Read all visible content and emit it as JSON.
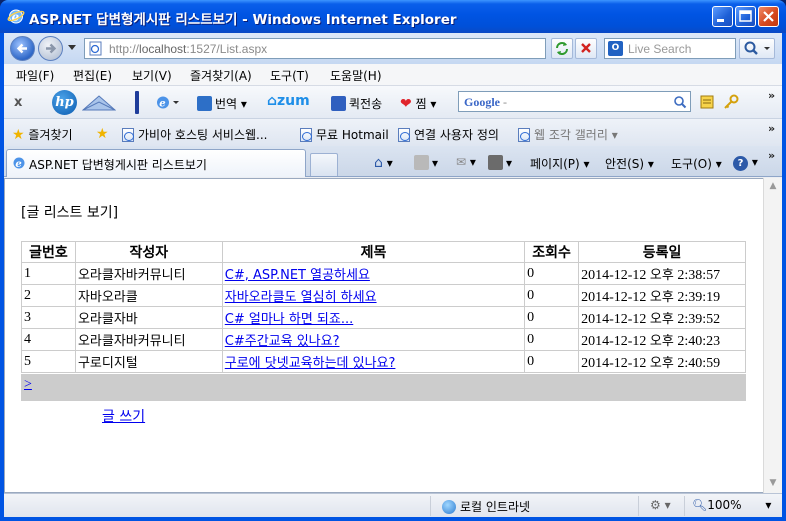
{
  "window": {
    "title": "ASP.NET 답변형게시판 리스트보기 - Windows Internet Explorer"
  },
  "address_bar": {
    "url_prefix": "http://",
    "url_host": "localhost",
    "url_rest": ":1527/List.aspx",
    "search_placeholder": "Live Search"
  },
  "menu": [
    "파일(F)",
    "편집(E)",
    "보기(V)",
    "즐겨찾기(A)",
    "도구(T)",
    "도움말(H)"
  ],
  "toolbar": {
    "close": "x",
    "translate": "번역",
    "zum": "zum",
    "quick_send": "퀵전송",
    "favorite": "찜",
    "google": "Google",
    "google_placeholder": "-"
  },
  "favorites_bar": {
    "label": "즐겨찾기",
    "items": [
      "가비아 호스팅 서비스웹...",
      "무료 Hotmail",
      "연결 사용자 정의",
      "웹 조각 갤러리"
    ]
  },
  "tab": {
    "label": "ASP.NET 답변형게시판 리스트보기"
  },
  "command_bar": {
    "page": "페이지(P)",
    "safety": "안전(S)",
    "tools": "도구(O)"
  },
  "page": {
    "heading": "[글 리스트 보기]",
    "columns": [
      "글번호",
      "작성자",
      "제목",
      "조회수",
      "등록일"
    ],
    "rows": [
      {
        "num": "1",
        "writer": "오라클자바커뮤니티",
        "title": "C#, ASP.NET 열공하세요",
        "views": "0",
        "date": "2014-12-12",
        "ampm": "오후",
        "time": "2:38:57"
      },
      {
        "num": "2",
        "writer": "자바오라클",
        "title": "자바오라클도 열심히 하세요",
        "views": "0",
        "date": "2014-12-12",
        "ampm": "오후",
        "time": "2:39:19"
      },
      {
        "num": "3",
        "writer": "오라클자바",
        "title": "C# 얼마나 하면 되죠...",
        "views": "0",
        "date": "2014-12-12",
        "ampm": "오후",
        "time": "2:39:52"
      },
      {
        "num": "4",
        "writer": "오라클자바커뮤니티",
        "title": "C#주간교육 있나요?",
        "views": "0",
        "date": "2014-12-12",
        "ampm": "오후",
        "time": "2:40:23"
      },
      {
        "num": "5",
        "writer": "구로디지털",
        "title": "구로에 닷넷교육하는데 있나요?",
        "views": "0",
        "date": "2014-12-12",
        "ampm": "오후",
        "time": "2:40:59"
      }
    ],
    "pager_next": ">",
    "write_link": "글 쓰기"
  },
  "status_bar": {
    "zone": "로컬 인트라넷",
    "zoom": "100%"
  }
}
